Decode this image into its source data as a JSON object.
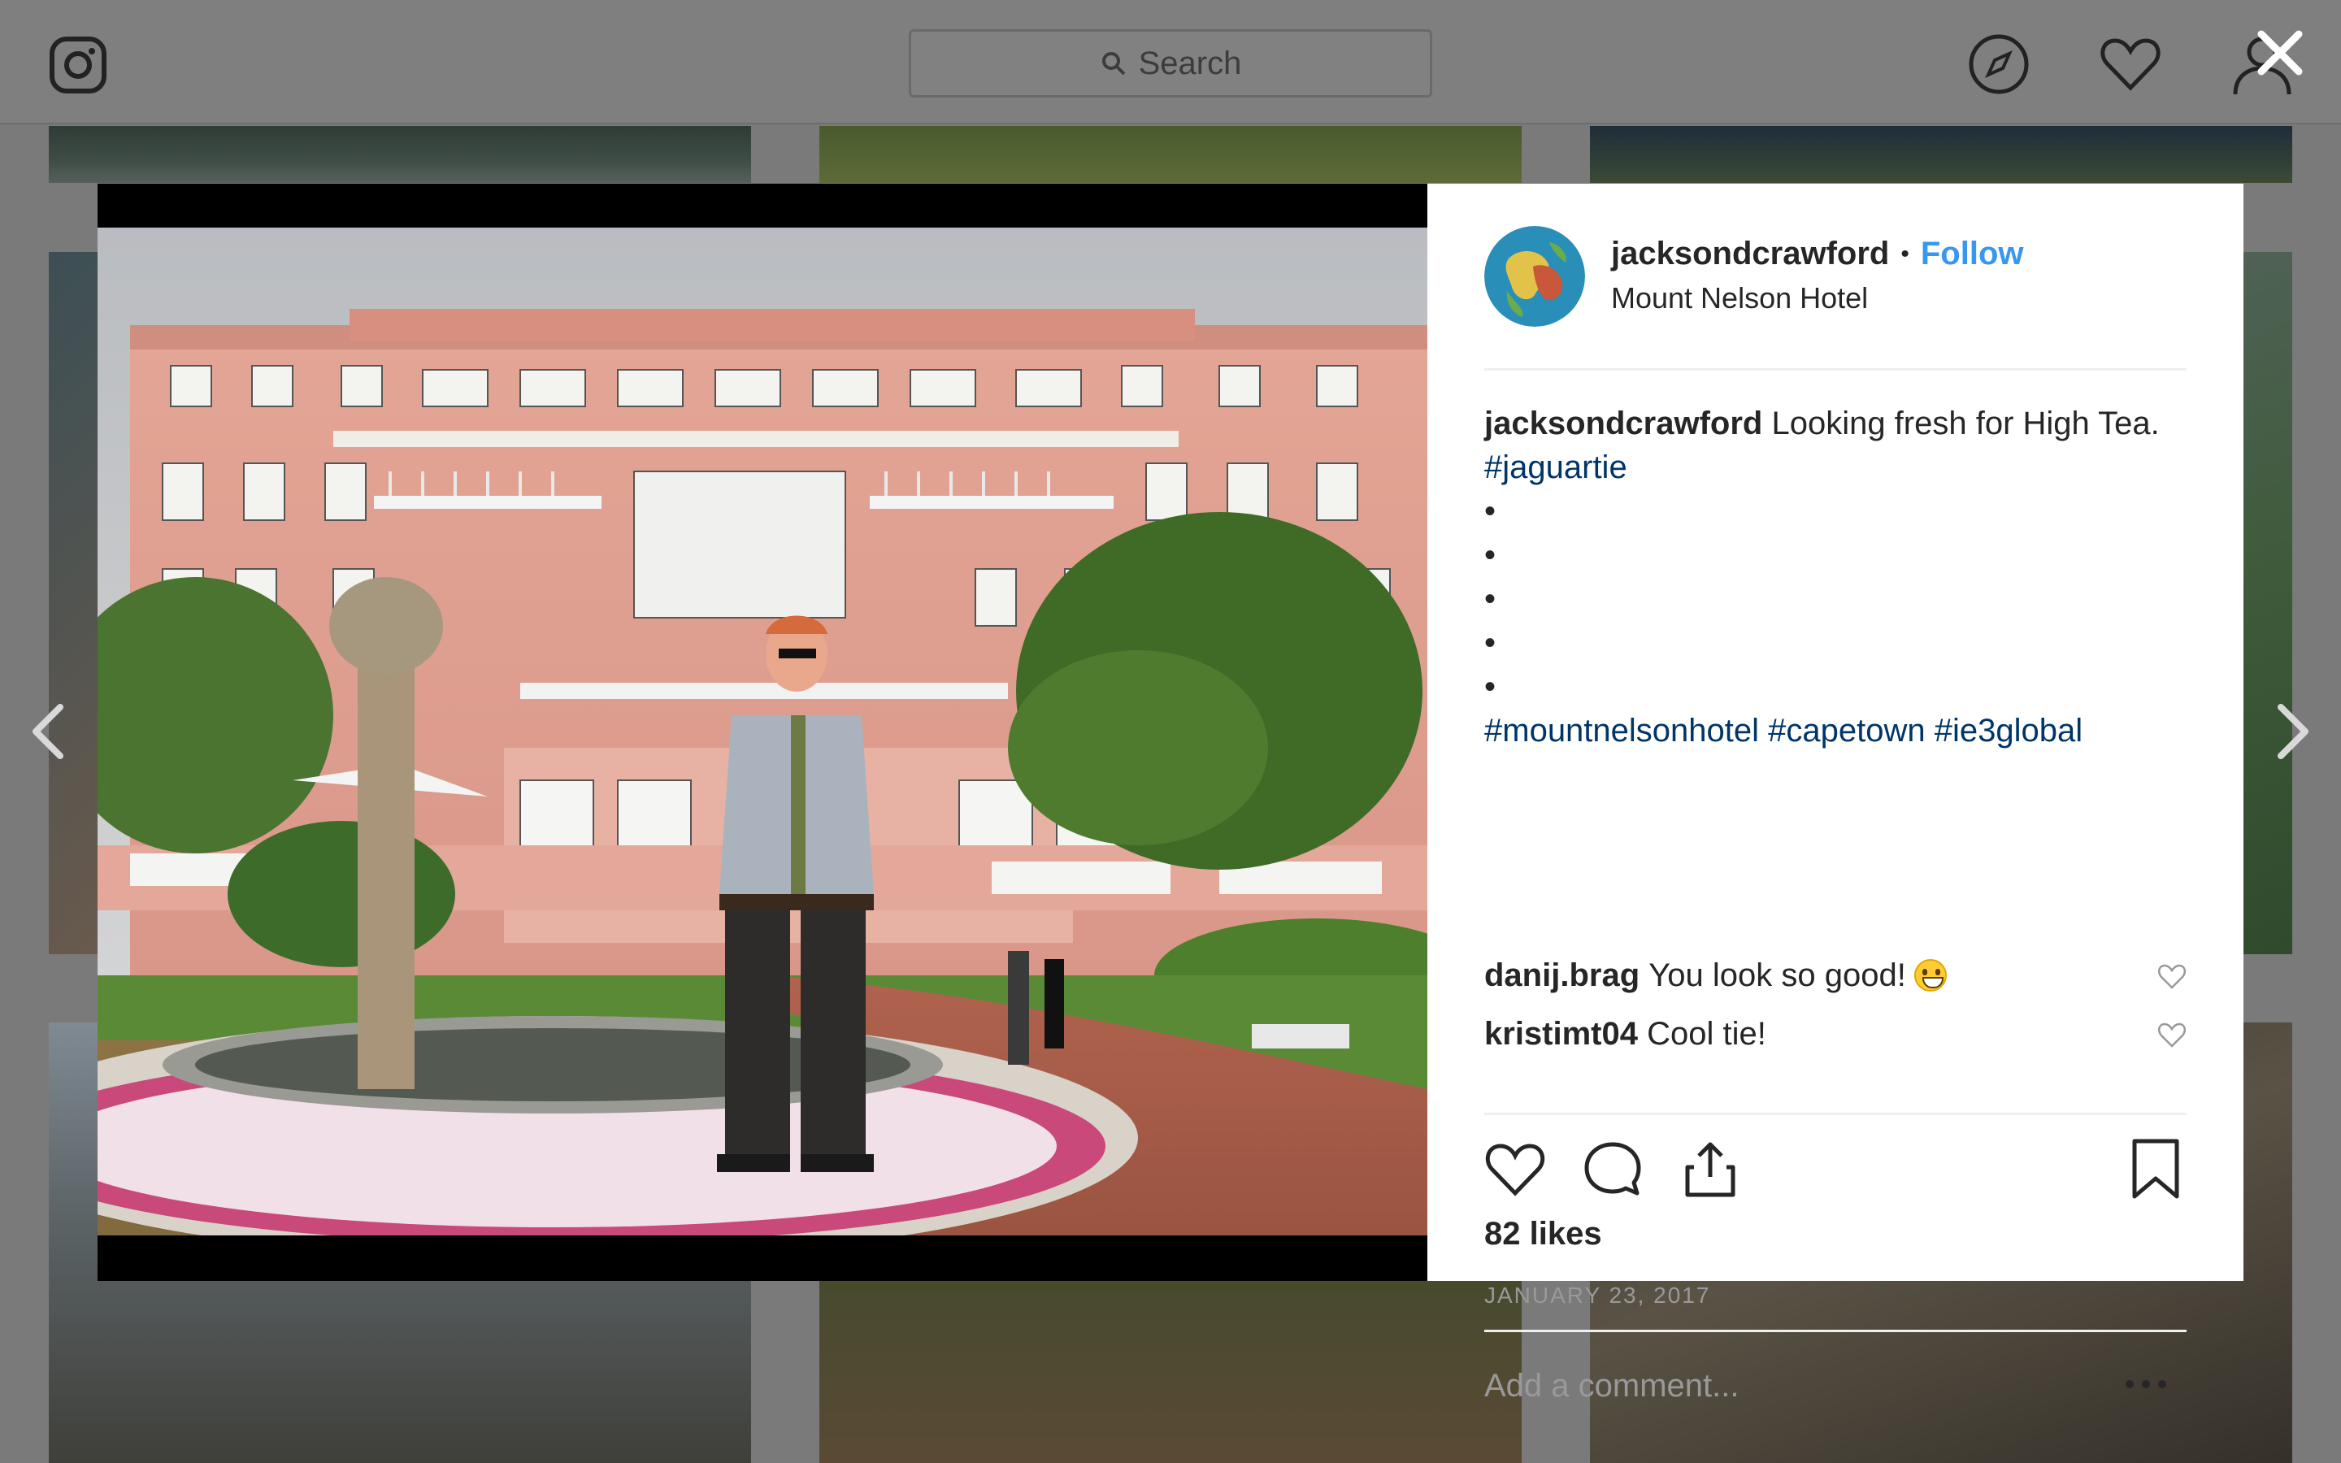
{
  "search": {
    "placeholder": "Search"
  },
  "post": {
    "username": "jacksondcrawford",
    "follow_label": "Follow",
    "location": "Mount Nelson Hotel",
    "caption": {
      "author": "jacksondcrawford",
      "text": "Looking fresh for High Tea.",
      "tag1": "#jaguartie",
      "bullets": [
        "",
        "",
        "",
        "",
        ""
      ],
      "tags": [
        "#mountnelsonhotel",
        "#capetown",
        "#ie3global"
      ]
    },
    "comments": [
      {
        "user": "danij.brag",
        "text": "You look so good!",
        "emoji": "grinning-face-emoji"
      },
      {
        "user": "kristimt04",
        "text": "Cool tie!"
      }
    ],
    "likes_label": "82 likes",
    "date_label": "JANUARY 23, 2017",
    "add_comment_placeholder": "Add a comment..."
  },
  "colors": {
    "link_blue": "#3897f0",
    "hashtag_blue": "#003569",
    "overlay_gray": "#7a7a7a"
  }
}
